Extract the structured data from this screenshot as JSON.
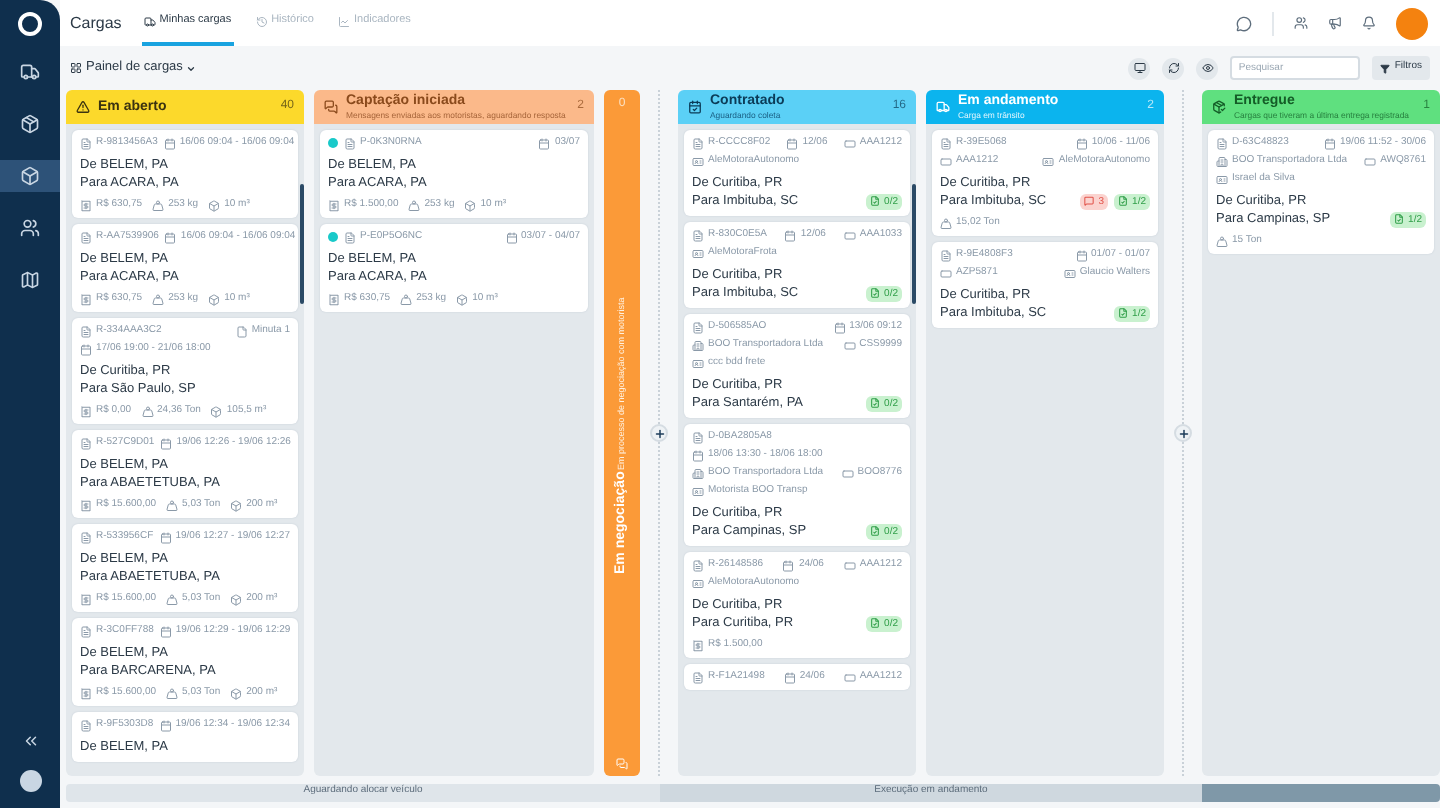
{
  "header": {
    "title": "Cargas",
    "tabs": [
      {
        "label": "Minhas cargas",
        "selected": true
      },
      {
        "label": "Histórico",
        "selected": false
      },
      {
        "label": "Indicadores",
        "selected": false
      }
    ]
  },
  "toolbar": {
    "board": "Painel de cargas",
    "search": {
      "placeholder": "Pesquisar"
    },
    "filter": "Filtros"
  },
  "columns": [
    {
      "kind": "list",
      "title": "Em aberto",
      "count": "40",
      "color": "#fcd92b",
      "cards": [
        {
          "meta": [
            [
              {
                "kind": "id",
                "text": "R-9813456A3"
              },
              {
                "kind": "date",
                "text": "16/06 09:04 - 16/06 09:04"
              }
            ]
          ],
          "from": "De BELEM, PA",
          "to": "Para ACARA, PA",
          "footer": [
            {
              "kind": "value",
              "text": "R$ 630,75"
            },
            {
              "kind": "weight",
              "text": "253 kg"
            },
            {
              "kind": "volume",
              "text": "10 m³"
            }
          ]
        },
        {
          "meta": [
            [
              {
                "kind": "id",
                "text": "R-AA7539906"
              },
              {
                "kind": "date",
                "text": "16/06 09:04 - 16/06 09:04"
              }
            ]
          ],
          "from": "De BELEM, PA",
          "to": "Para ACARA, PA",
          "footer": [
            {
              "kind": "value",
              "text": "R$ 630,75"
            },
            {
              "kind": "weight",
              "text": "253 kg"
            },
            {
              "kind": "volume",
              "text": "10 m³"
            }
          ]
        },
        {
          "meta": [
            [
              {
                "kind": "id",
                "text": "R-334AAA3C2"
              },
              {
                "kind": "doc",
                "text": "Minuta 1"
              }
            ],
            [
              {
                "kind": "date",
                "text": "17/06 19:00 - 21/06 18:00"
              }
            ]
          ],
          "from": "De Curitiba, PR",
          "to": "Para São Paulo, SP",
          "footer": [
            {
              "kind": "value",
              "text": "R$ 0,00"
            },
            {
              "kind": "weight",
              "text": "24,36 Ton"
            },
            {
              "kind": "volume",
              "text": "105,5 m³"
            }
          ]
        },
        {
          "meta": [
            [
              {
                "kind": "id",
                "text": "R-527C9D01"
              },
              {
                "kind": "date",
                "text": "19/06 12:26 - 19/06 12:26"
              }
            ]
          ],
          "from": "De BELEM, PA",
          "to": "Para ABAETETUBA, PA",
          "footer": [
            {
              "kind": "value",
              "text": "R$ 15.600,00"
            },
            {
              "kind": "weight",
              "text": "5,03 Ton"
            },
            {
              "kind": "volume",
              "text": "200 m³"
            }
          ]
        },
        {
          "meta": [
            [
              {
                "kind": "id",
                "text": "R-533956CF"
              },
              {
                "kind": "date",
                "text": "19/06 12:27 - 19/06 12:27"
              }
            ]
          ],
          "from": "De BELEM, PA",
          "to": "Para ABAETETUBA, PA",
          "footer": [
            {
              "kind": "value",
              "text": "R$ 15.600,00"
            },
            {
              "kind": "weight",
              "text": "5,03 Ton"
            },
            {
              "kind": "volume",
              "text": "200 m³"
            }
          ]
        },
        {
          "meta": [
            [
              {
                "kind": "id",
                "text": "R-3C0FF788"
              },
              {
                "kind": "date",
                "text": "19/06 12:29 - 19/06 12:29"
              }
            ]
          ],
          "from": "De BELEM, PA",
          "to": "Para BARCARENA, PA",
          "footer": [
            {
              "kind": "value",
              "text": "R$ 15.600,00"
            },
            {
              "kind": "weight",
              "text": "5,03 Ton"
            },
            {
              "kind": "volume",
              "text": "200 m³"
            }
          ]
        },
        {
          "meta": [
            [
              {
                "kind": "id",
                "text": "R-9F5303D8"
              },
              {
                "kind": "date",
                "text": "19/06 12:34 - 19/06 12:34"
              }
            ]
          ],
          "from": "De BELEM, PA"
        }
      ]
    },
    {
      "kind": "list",
      "title": "Captação iniciada",
      "subtitle": "Mensagens enviadas aos motoristas, aguardando resposta",
      "count": "2",
      "color": "#fbb98a",
      "cards": [
        {
          "color": "#19c9c9",
          "meta": [
            [
              {
                "kind": "id",
                "text": "P-0K3N0RNA"
              },
              {
                "kind": "date",
                "text": "03/07"
              }
            ]
          ],
          "from": "De BELEM, PA",
          "to": "Para ACARA, PA",
          "footer": [
            {
              "kind": "value",
              "text": "R$ 1.500,00"
            },
            {
              "kind": "weight",
              "text": "253 kg"
            },
            {
              "kind": "volume",
              "text": "10 m³"
            }
          ]
        },
        {
          "color": "#19c9c9",
          "meta": [
            [
              {
                "kind": "id",
                "text": "P-E0P5O6NC"
              },
              {
                "kind": "date",
                "text": "03/07 - 04/07"
              }
            ]
          ],
          "from": "De BELEM, PA",
          "to": "Para ACARA, PA",
          "footer": [
            {
              "kind": "value",
              "text": "R$ 630,75"
            },
            {
              "kind": "weight",
              "text": "253 kg"
            },
            {
              "kind": "volume",
              "text": "10 m³"
            }
          ]
        }
      ]
    },
    {
      "kind": "collapsed",
      "title": "Em negociação",
      "subtitle": "Em processo de negociação com motorista",
      "count": "0",
      "color": "#fb9a38"
    },
    {
      "kind": "list",
      "title": "Contratado",
      "subtitle": "Aguardando coleta",
      "count": "16",
      "color": "#5bd0f6",
      "cards": [
        {
          "meta": [
            [
              {
                "kind": "id",
                "text": "R-CCCC8F02"
              },
              {
                "kind": "date",
                "text": "12/06"
              },
              {
                "kind": "plate",
                "text": "AAA1212"
              }
            ],
            [
              {
                "kind": "driver",
                "text": "AleMotoraAutonomo"
              }
            ]
          ],
          "from": "De Curitiba, PR",
          "to": "Para Imbituba, SC",
          "badges": [
            {
              "kind": "docs",
              "text": "0/2"
            }
          ]
        },
        {
          "meta": [
            [
              {
                "kind": "id",
                "text": "R-830C0E5A"
              },
              {
                "kind": "date",
                "text": "12/06"
              },
              {
                "kind": "plate",
                "text": "AAA1033"
              }
            ],
            [
              {
                "kind": "driver",
                "text": "AleMotoraFrota"
              }
            ]
          ],
          "from": "De Curitiba, PR",
          "to": "Para Imbituba, SC",
          "badges": [
            {
              "kind": "docs",
              "text": "0/2"
            }
          ]
        },
        {
          "meta": [
            [
              {
                "kind": "id",
                "text": "D-506585AO"
              },
              {
                "kind": "date",
                "text": "13/06 09:12"
              }
            ],
            [
              {
                "kind": "carrier",
                "text": "BOO Transportadora Ltda"
              },
              {
                "kind": "plate",
                "text": "CSS9999"
              }
            ],
            [
              {
                "kind": "driver",
                "text": "ccc bdd frete"
              }
            ]
          ],
          "from": "De Curitiba, PR",
          "to": "Para Santarém, PA",
          "badges": [
            {
              "kind": "docs",
              "text": "0/2"
            }
          ]
        },
        {
          "meta": [
            [
              {
                "kind": "id",
                "text": "D-0BA2805A8"
              }
            ],
            [
              {
                "kind": "date",
                "text": "18/06 13:30 - 18/06 18:00"
              }
            ],
            [
              {
                "kind": "carrier",
                "text": "BOO Transportadora Ltda"
              },
              {
                "kind": "plate",
                "text": "BOO8776"
              }
            ],
            [
              {
                "kind": "driver",
                "text": "Motorista BOO Transp"
              }
            ]
          ],
          "from": "De Curitiba, PR",
          "to": "Para Campinas, SP",
          "badges": [
            {
              "kind": "docs",
              "text": "0/2"
            }
          ]
        },
        {
          "meta": [
            [
              {
                "kind": "id",
                "text": "R-26148586"
              },
              {
                "kind": "date",
                "text": "24/06"
              },
              {
                "kind": "plate",
                "text": "AAA1212"
              }
            ],
            [
              {
                "kind": "driver",
                "text": "AleMotoraAutonomo"
              }
            ]
          ],
          "from": "De Curitiba, PR",
          "to": "Para Curitiba, PR",
          "badges": [
            {
              "kind": "docs",
              "text": "0/2"
            }
          ],
          "footer": [
            {
              "kind": "value",
              "text": "R$ 1.500,00"
            }
          ]
        },
        {
          "meta": [
            [
              {
                "kind": "id",
                "text": "R-F1A21498"
              },
              {
                "kind": "date",
                "text": "24/06"
              },
              {
                "kind": "plate",
                "text": "AAA1212"
              }
            ]
          ]
        }
      ]
    },
    {
      "kind": "list",
      "title": "Em andamento",
      "subtitle": "Carga em trânsito",
      "count": "2",
      "color": "#0bb4ee",
      "cards": [
        {
          "meta": [
            [
              {
                "kind": "id",
                "text": "R-39E5068"
              },
              {
                "kind": "date",
                "text": "10/06 - 11/06"
              }
            ],
            [
              {
                "kind": "plate",
                "text": "AAA1212"
              },
              {
                "kind": "driver",
                "text": "AleMotoraAutonomo"
              }
            ]
          ],
          "from": "De Curitiba, PR",
          "to": "Para Imbituba, SC",
          "badges": [
            {
              "kind": "alert",
              "text": "3"
            },
            {
              "kind": "docs",
              "text": "1/2"
            }
          ],
          "footer": [
            {
              "kind": "weight",
              "text": "15,02 Ton"
            }
          ]
        },
        {
          "meta": [
            [
              {
                "kind": "id",
                "text": "R-9E4808F3"
              },
              {
                "kind": "date",
                "text": "01/07 - 01/07"
              }
            ],
            [
              {
                "kind": "plate",
                "text": "AZP5871"
              },
              {
                "kind": "driver",
                "text": "Glaucio Walters"
              }
            ]
          ],
          "from": "De Curitiba, PR",
          "to": "Para Imbituba, SC",
          "badges": [
            {
              "kind": "docs",
              "text": "1/2"
            }
          ]
        }
      ]
    },
    {
      "kind": "list",
      "title": "Entregue",
      "subtitle": "Cargas que tiveram a última entrega registrada",
      "count": "1",
      "color": "#5fe07f",
      "cards": [
        {
          "meta": [
            [
              {
                "kind": "id",
                "text": "D-63C48823"
              },
              {
                "kind": "date",
                "text": "19/06 11:52 - 30/06"
              }
            ],
            [
              {
                "kind": "carrier",
                "text": "BOO Transportadora Ltda"
              },
              {
                "kind": "plate",
                "text": "AWQ8761"
              }
            ],
            [
              {
                "kind": "driver",
                "text": "Israel da Silva"
              }
            ]
          ],
          "from": "De Curitiba, PR",
          "to": "Para Campinas, SP",
          "badges": [
            {
              "kind": "docs",
              "text": "1/2"
            }
          ],
          "footer": [
            {
              "kind": "weight",
              "text": "15 Ton"
            }
          ]
        }
      ]
    }
  ],
  "stages": [
    "Aguardando alocar veículo",
    "Execução em andamento"
  ]
}
